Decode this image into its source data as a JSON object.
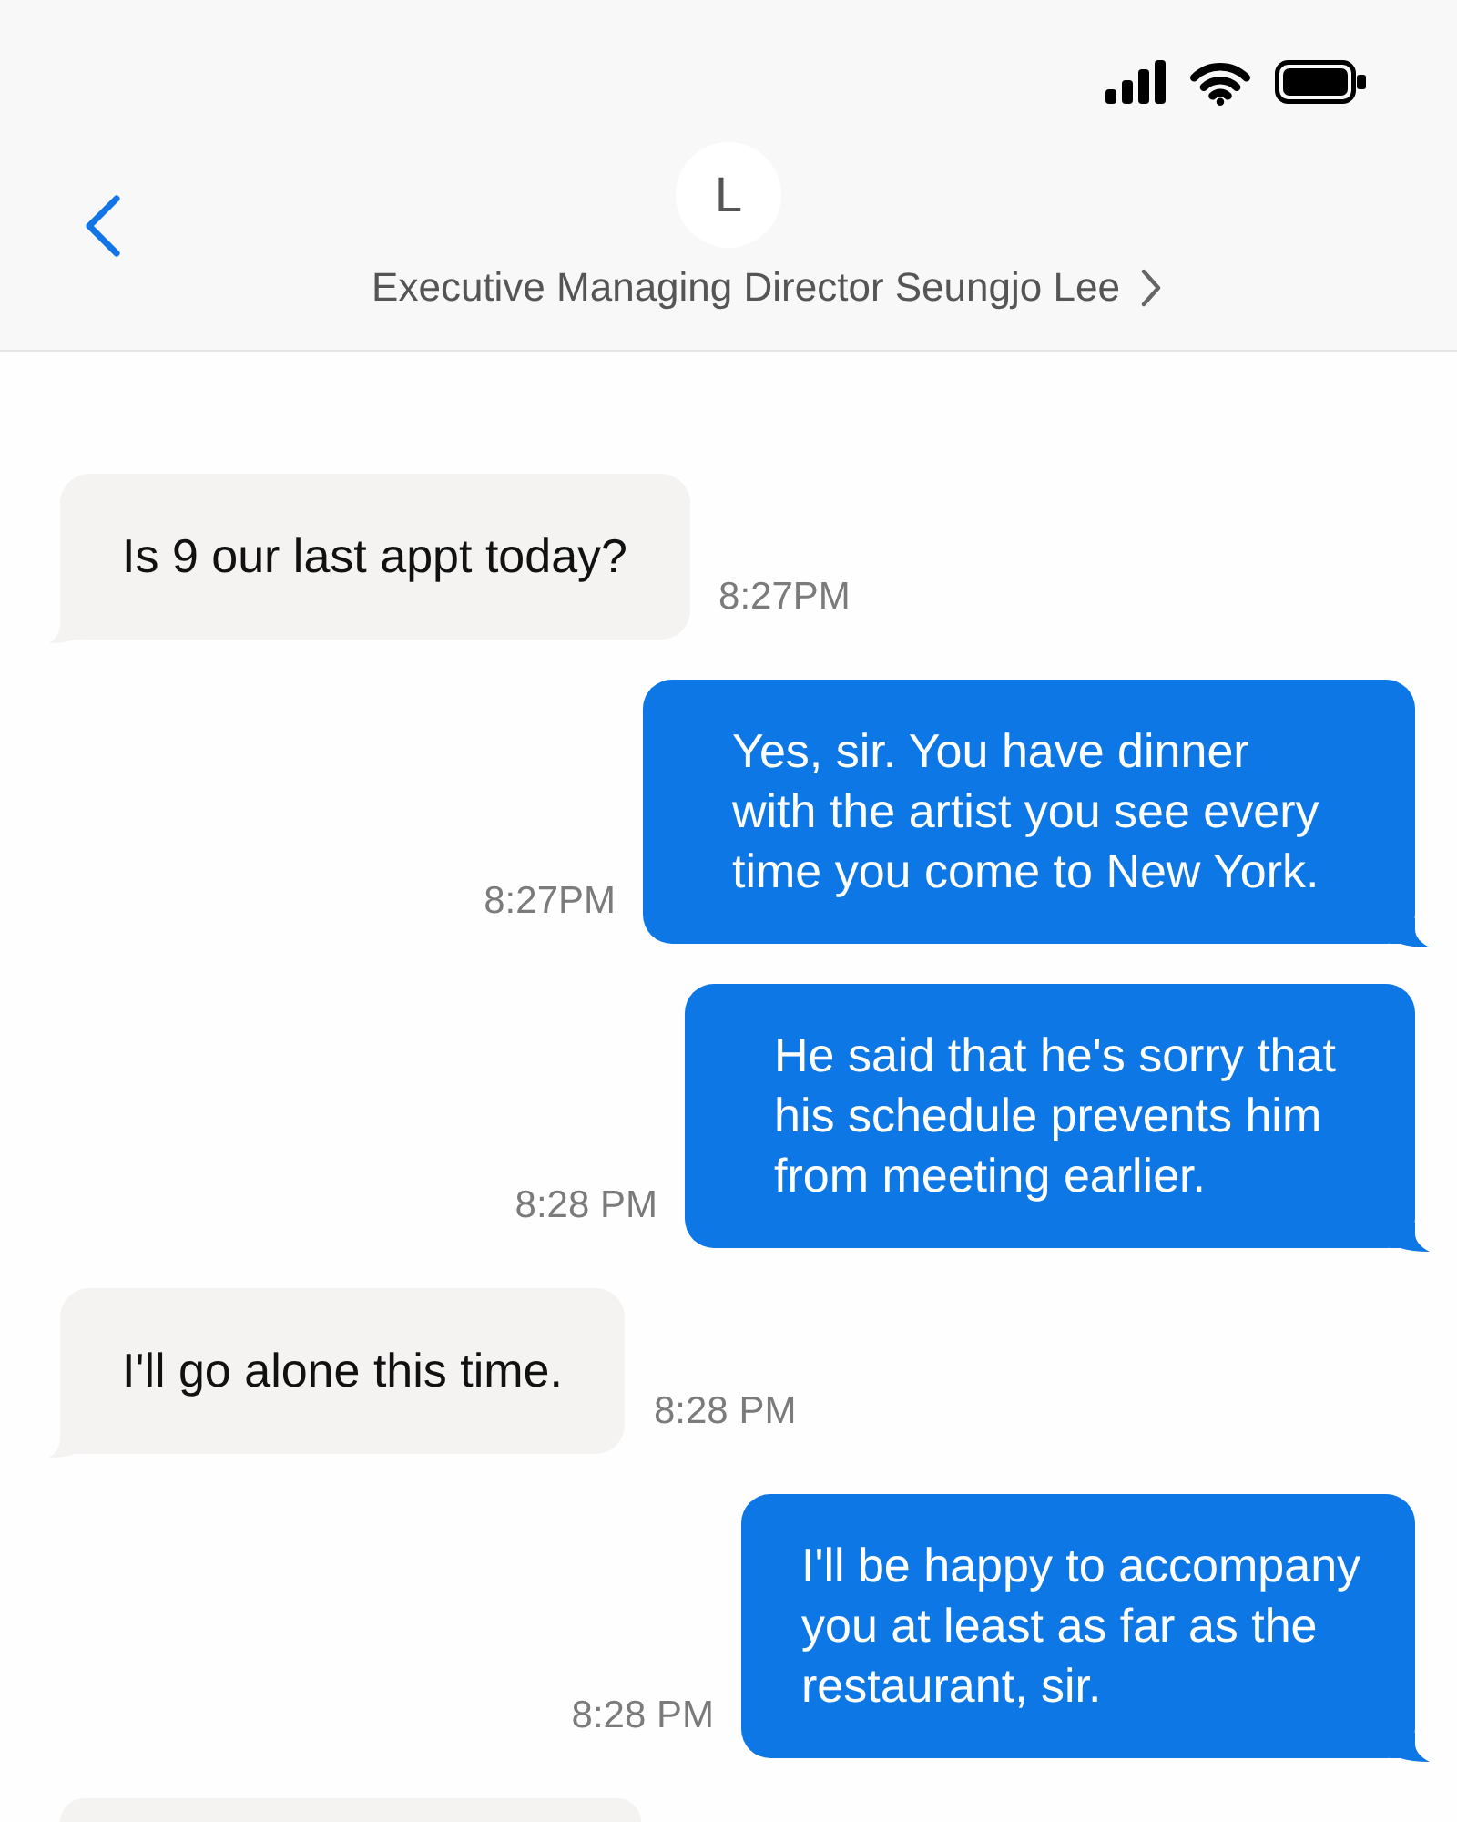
{
  "header": {
    "avatar_initial": "L",
    "contact_name": "Executive Managing Director Seungjo Lee"
  },
  "messages": [
    {
      "kind": "received",
      "text": "Is 9 our last appt today?",
      "time": "8:27PM"
    },
    {
      "kind": "sent",
      "text": "Yes, sir. You have dinner with the artist you see every time you come to New York.",
      "time": "8:27PM"
    },
    {
      "kind": "sent",
      "text": "He said that he's sorry that his schedule prevents him from meeting earlier.",
      "time": "8:28 PM"
    },
    {
      "kind": "received",
      "text": "I'll go alone this time.",
      "time": "8:28 PM"
    },
    {
      "kind": "sent",
      "text": "I'll be happy to accompany you at least as far as the restaurant, sir.",
      "time": "8:28 PM"
    },
    {
      "kind": "received"
    }
  ]
}
